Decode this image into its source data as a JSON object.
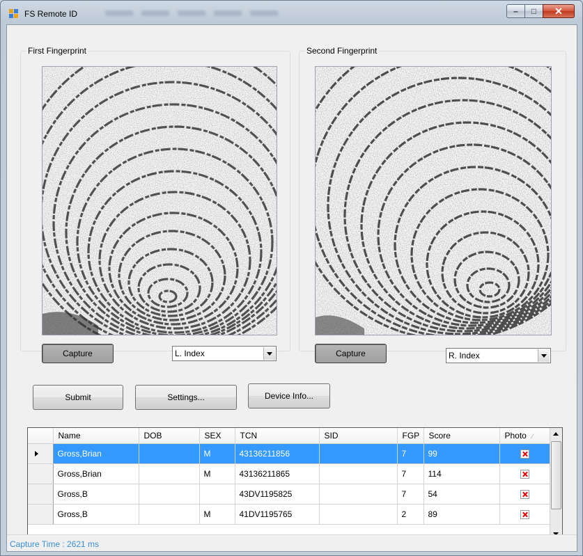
{
  "window": {
    "title": "FS Remote ID",
    "controls": {
      "minimize": "–",
      "maximize": "□",
      "close": "✕"
    }
  },
  "first_fingerprint": {
    "legend": "First Fingerprint",
    "capture_label": "Capture",
    "finger_select": "L. Index"
  },
  "second_fingerprint": {
    "legend": "Second Fingerprint",
    "capture_label": "Capture",
    "finger_select": "R. Index"
  },
  "actions": {
    "submit_label": "Submit",
    "settings_label": "Settings...",
    "device_info_label": "Device Info..."
  },
  "results": {
    "columns": [
      "Name",
      "DOB",
      "SEX",
      "TCN",
      "SID",
      "FGP",
      "Score",
      "Photo"
    ],
    "rows": [
      {
        "name": "Gross,Brian",
        "dob": "",
        "sex": "M",
        "tcn": "43136211856",
        "sid": "",
        "fgp": "7",
        "score": "99",
        "selected": true
      },
      {
        "name": "Gross,Brian",
        "dob": "",
        "sex": "M",
        "tcn": "43136211865",
        "sid": "",
        "fgp": "7",
        "score": "114",
        "selected": false
      },
      {
        "name": "Gross,B",
        "dob": "",
        "sex": "",
        "tcn": "43DV1195825",
        "sid": "",
        "fgp": "7",
        "score": "54",
        "selected": false
      },
      {
        "name": "Gross,B",
        "dob": "",
        "sex": "M",
        "tcn": "41DV1195765",
        "sid": "",
        "fgp": "2",
        "score": "89",
        "selected": false
      }
    ]
  },
  "status": {
    "text": "Capture Time : 2621 ms"
  },
  "colors": {
    "selection": "#3399ff",
    "status_text": "#3a8fd6",
    "close_button": "#c13a1e"
  }
}
